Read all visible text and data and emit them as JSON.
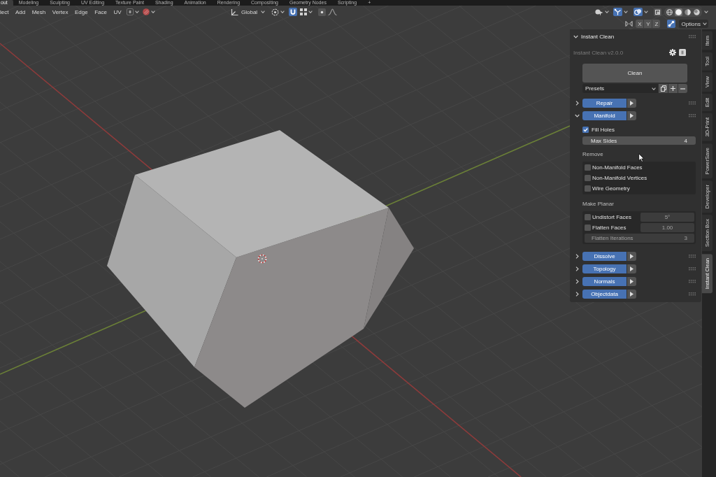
{
  "workspace_tabs": [
    {
      "label": "out",
      "selected": true
    },
    {
      "label": "Modeling",
      "selected": false
    },
    {
      "label": "Sculpting",
      "selected": false
    },
    {
      "label": "UV Editing",
      "selected": false
    },
    {
      "label": "Texture Paint",
      "selected": false
    },
    {
      "label": "Shading",
      "selected": false
    },
    {
      "label": "Animation",
      "selected": false
    },
    {
      "label": "Rendering",
      "selected": false
    },
    {
      "label": "Compositing",
      "selected": false
    },
    {
      "label": "Geometry Nodes",
      "selected": false
    },
    {
      "label": "Scripting",
      "selected": false
    }
  ],
  "add_workspace": "+",
  "header": {
    "menus": [
      "lect",
      "Add",
      "Mesh",
      "Vertex",
      "Edge",
      "Face",
      "UV"
    ],
    "orientation": "Global",
    "snap": {
      "on": true
    },
    "proportional_editing": {
      "on": false
    },
    "navigation_gizmo": {
      "on": true
    },
    "overlays": {
      "on": true
    },
    "xray": {
      "on": false
    },
    "shading_modes": [
      {
        "kind": "wireframe",
        "selected": false
      },
      {
        "kind": "solid",
        "selected": true
      },
      {
        "kind": "material",
        "selected": false
      },
      {
        "kind": "rendered",
        "selected": false
      }
    ],
    "mirror_axes": [
      {
        "label": "X",
        "on": false
      },
      {
        "label": "Y",
        "on": false
      },
      {
        "label": "Z",
        "on": false
      }
    ],
    "auto_merge": {
      "on": true
    },
    "options": "Options"
  },
  "sidebar": {
    "tabs": [
      {
        "label": "Item",
        "selected": false
      },
      {
        "label": "Tool",
        "selected": false
      },
      {
        "label": "View",
        "selected": false
      },
      {
        "label": "Edit",
        "selected": false
      },
      {
        "label": "3D-Print",
        "selected": false
      },
      {
        "label": "PowerSave",
        "selected": false
      },
      {
        "label": "Developer",
        "selected": false
      },
      {
        "label": "Section Box",
        "selected": false
      },
      {
        "label": "Instant Clean",
        "selected": true
      }
    ],
    "panel": {
      "title": "Instant Clean",
      "expanded": true,
      "version": "Instant Clean v2.0.0",
      "clean": "Clean",
      "presets": "Presets",
      "sections": [
        {
          "label": "Repair",
          "expanded": false
        },
        {
          "label": "Manifold",
          "expanded": true,
          "content": {
            "fill_holes": {
              "label": "Fill Holes",
              "checked": true
            },
            "max_sides": {
              "label": "Max Sides",
              "value": "4"
            },
            "remove": {
              "heading": "Remove",
              "options": [
                {
                  "label": "Non-Manifold Faces",
                  "checked": false
                },
                {
                  "label": "Non-Manifold Vertices",
                  "checked": false
                },
                {
                  "label": "Wire Geometry",
                  "checked": false
                }
              ]
            },
            "make_planar": {
              "heading": "Make Planar",
              "rows": [
                {
                  "kind": "toggle_value",
                  "label": "Undistort Faces",
                  "checked": false,
                  "value": "5°",
                  "disabled": true
                },
                {
                  "kind": "toggle_value",
                  "label": "Flatten Faces",
                  "checked": false,
                  "value": "1.00",
                  "disabled": true
                },
                {
                  "kind": "value",
                  "label": "Flatten Iterations",
                  "value": "3",
                  "disabled": true
                }
              ]
            }
          }
        },
        {
          "label": "Dissolve",
          "expanded": false
        },
        {
          "label": "Topology",
          "expanded": false
        },
        {
          "label": "Normals",
          "expanded": false
        },
        {
          "label": "Objectdata",
          "expanded": false
        }
      ]
    }
  }
}
